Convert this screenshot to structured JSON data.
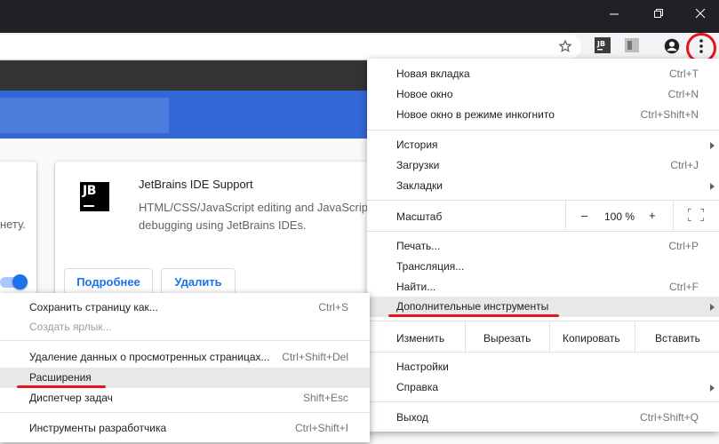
{
  "colors": {
    "accent": "#1a73e8",
    "highlight_red": "#e8121b",
    "header_blue": "#3367d6"
  },
  "toolbar": {
    "icons": [
      "star-icon",
      "jetbrains-extension-icon",
      "extension-icon",
      "account-icon",
      "more-vert-icon"
    ]
  },
  "page": {
    "left_card_fragment": "нету.",
    "extension": {
      "logo_text": "JB",
      "title": "JetBrains IDE Support",
      "desc_line1": "HTML/CSS/JavaScript editing and JavaScript",
      "desc_line2": "debugging using JetBrains IDEs.",
      "details_button": "Подробнее",
      "remove_button": "Удалить"
    }
  },
  "menu": {
    "new_tab": {
      "label": "Новая вкладка",
      "shortcut": "Ctrl+T"
    },
    "new_window": {
      "label": "Новое окно",
      "shortcut": "Ctrl+N"
    },
    "incognito": {
      "label": "Новое окно в режиме инкогнито",
      "shortcut": "Ctrl+Shift+N"
    },
    "history": {
      "label": "История"
    },
    "downloads": {
      "label": "Загрузки",
      "shortcut": "Ctrl+J"
    },
    "bookmarks": {
      "label": "Закладки"
    },
    "zoom": {
      "label": "Масштаб",
      "minus": "–",
      "value": "100 %",
      "plus": "+"
    },
    "print": {
      "label": "Печать...",
      "shortcut": "Ctrl+P"
    },
    "cast": {
      "label": "Трансляция..."
    },
    "find": {
      "label": "Найти...",
      "shortcut": "Ctrl+F"
    },
    "more_tools": {
      "label": "Дополнительные инструменты"
    },
    "edit": {
      "label": "Изменить",
      "cut": "Вырезать",
      "copy": "Копировать",
      "paste": "Вставить"
    },
    "settings": {
      "label": "Настройки"
    },
    "help": {
      "label": "Справка"
    },
    "exit": {
      "label": "Выход",
      "shortcut": "Ctrl+Shift+Q"
    }
  },
  "submenu": {
    "save_page": {
      "label": "Сохранить страницу как...",
      "shortcut": "Ctrl+S"
    },
    "create_shortcut": {
      "label": "Создать ярлык..."
    },
    "clear_data": {
      "label": "Удаление данных о просмотренных страницах...",
      "shortcut": "Ctrl+Shift+Del"
    },
    "extensions": {
      "label": "Расширения"
    },
    "task_manager": {
      "label": "Диспетчер задач",
      "shortcut": "Shift+Esc"
    },
    "dev_tools": {
      "label": "Инструменты разработчика",
      "shortcut": "Ctrl+Shift+I"
    }
  }
}
